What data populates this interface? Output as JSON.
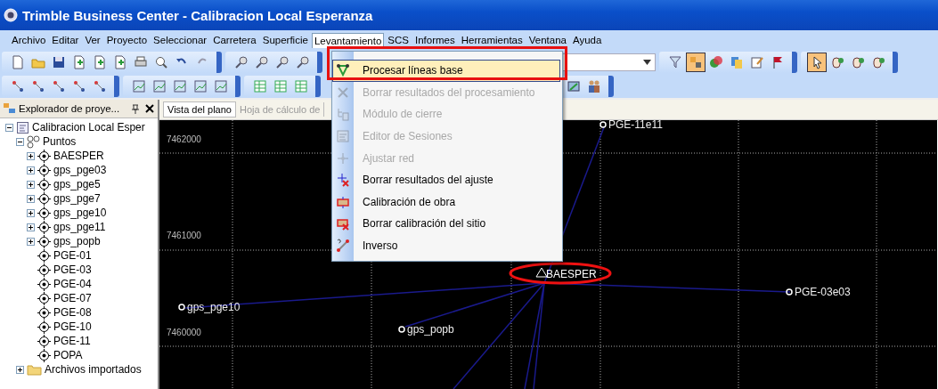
{
  "window": {
    "title": "Trimble Business Center - Calibracion Local Esperanza"
  },
  "menu_bar": [
    {
      "label": "Archivo",
      "selected": false
    },
    {
      "label": "Editar",
      "selected": false
    },
    {
      "label": "Ver",
      "selected": false
    },
    {
      "label": "Proyecto",
      "selected": false
    },
    {
      "label": "Seleccionar",
      "selected": false
    },
    {
      "label": "Carretera",
      "selected": false
    },
    {
      "label": "Superficie",
      "selected": false
    },
    {
      "label": "Levantamiento",
      "selected": true
    },
    {
      "label": "SCS",
      "selected": false
    },
    {
      "label": "Informes",
      "selected": false
    },
    {
      "label": "Herramientas",
      "selected": false
    },
    {
      "label": "Ventana",
      "selected": false
    },
    {
      "label": "Ayuda",
      "selected": false
    }
  ],
  "dropdown_menu": [
    {
      "label": "Procesar líneas base",
      "disabled": false,
      "selected": true
    },
    {
      "label": "Borrar resultados del procesamiento",
      "disabled": true,
      "selected": false
    },
    {
      "label": "Módulo de cierre",
      "disabled": true,
      "selected": false
    },
    {
      "label": "Editor de Sesiones",
      "disabled": true,
      "selected": false
    },
    {
      "label": "Ajustar red",
      "disabled": true,
      "selected": false
    },
    {
      "label": "Borrar resultados del ajuste",
      "disabled": false,
      "selected": false
    },
    {
      "label": "Calibración de obra",
      "disabled": false,
      "selected": false
    },
    {
      "label": "Borrar calibración del sitio",
      "disabled": false,
      "selected": false
    },
    {
      "label": "Inverso",
      "disabled": false,
      "selected": false
    }
  ],
  "explorer": {
    "title": "Explorador de proye...",
    "tree": [
      {
        "label": "Calibracion Local Esper",
        "kind": "project",
        "expanded": true,
        "children": [
          {
            "label": "Puntos",
            "kind": "group",
            "expanded": true,
            "children": [
              {
                "label": "BAESPER",
                "kind": "point",
                "expanded": false
              },
              {
                "label": "gps_pge03",
                "kind": "point",
                "expanded": false
              },
              {
                "label": "gps_pge5",
                "kind": "point",
                "expanded": false
              },
              {
                "label": "gps_pge7",
                "kind": "point",
                "expanded": false
              },
              {
                "label": "gps_pge10",
                "kind": "point",
                "expanded": false
              },
              {
                "label": "gps_pge11",
                "kind": "point",
                "expanded": false
              },
              {
                "label": "gps_popb",
                "kind": "point",
                "expanded": false
              },
              {
                "label": "PGE-01",
                "kind": "point"
              },
              {
                "label": "PGE-03",
                "kind": "point"
              },
              {
                "label": "PGE-04",
                "kind": "point"
              },
              {
                "label": "PGE-07",
                "kind": "point"
              },
              {
                "label": "PGE-08",
                "kind": "point"
              },
              {
                "label": "PGE-10",
                "kind": "point"
              },
              {
                "label": "PGE-11",
                "kind": "point"
              },
              {
                "label": "POPA",
                "kind": "point"
              }
            ]
          },
          {
            "label": "Archivos importados",
            "kind": "folder",
            "expanded": false
          }
        ]
      }
    ]
  },
  "view_tabs": [
    {
      "label": "Vista del plano",
      "selected": true
    },
    {
      "label": "Hoja de cálculo de",
      "selected": false
    }
  ],
  "plan_view": {
    "northings": [
      "7462000",
      "7461000",
      "7460000"
    ],
    "points": [
      {
        "label": "PGE-11e11",
        "kind": "point"
      },
      {
        "label": "BAESPER",
        "kind": "control"
      },
      {
        "label": "PGE-03e03",
        "kind": "point"
      },
      {
        "label": "gps_pge10",
        "kind": "point"
      },
      {
        "label": "gps_popb",
        "kind": "point"
      }
    ]
  }
}
